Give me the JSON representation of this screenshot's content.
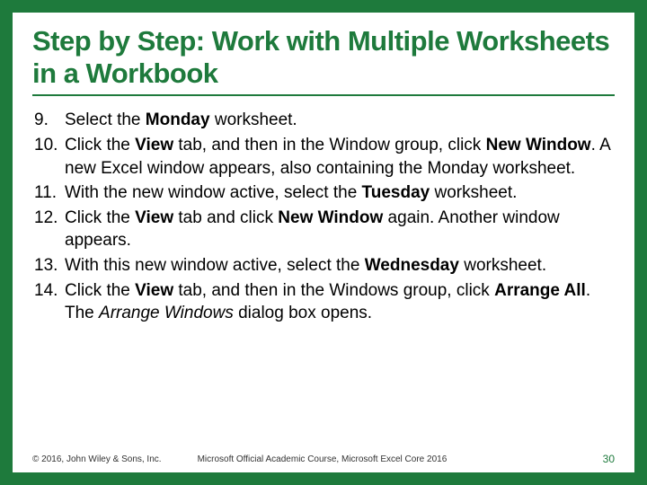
{
  "title": "Step by Step: Work with Multiple Worksheets in a Workbook",
  "steps": [
    {
      "num": "9.",
      "parts": [
        "Select the ",
        {
          "b": "Monday"
        },
        " worksheet."
      ]
    },
    {
      "num": "10.",
      "parts": [
        "Click the ",
        {
          "b": "View"
        },
        " tab, and then in the Window group, click ",
        {
          "b": "New Window"
        },
        ". A new Excel window appears, also containing the Monday worksheet."
      ]
    },
    {
      "num": "11.",
      "parts": [
        "With the new window active, select the ",
        {
          "b": "Tuesday"
        },
        " worksheet."
      ]
    },
    {
      "num": "12.",
      "parts": [
        "Click the ",
        {
          "b": "View"
        },
        " tab and click ",
        {
          "b": "New Window"
        },
        " again. Another window appears."
      ]
    },
    {
      "num": "13.",
      "parts": [
        "With this new window active, select the ",
        {
          "b": "Wednesday"
        },
        " worksheet."
      ]
    },
    {
      "num": "14.",
      "parts": [
        "Click the ",
        {
          "b": "View"
        },
        " tab, and then in the Windows group, click ",
        {
          "b": "Arrange All"
        },
        ". The ",
        {
          "i": "Arrange Windows"
        },
        " dialog box opens."
      ]
    }
  ],
  "footer": {
    "copyright": "© 2016, John Wiley & Sons, Inc.",
    "course": "Microsoft Official Academic Course, Microsoft Excel Core 2016",
    "page": "30"
  }
}
